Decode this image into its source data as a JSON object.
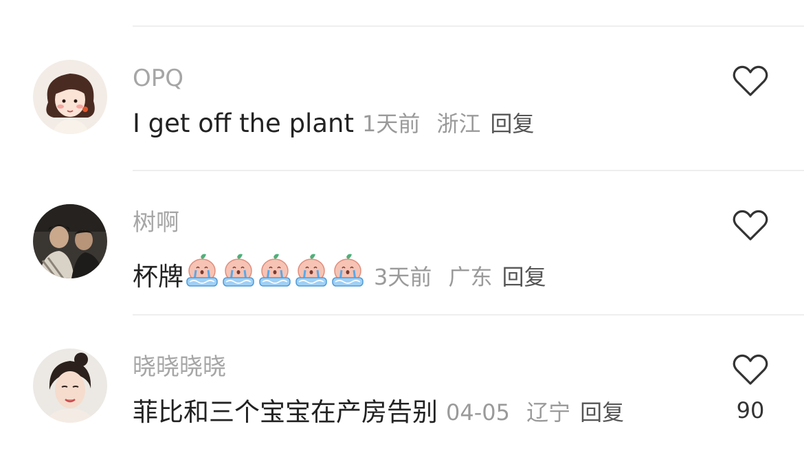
{
  "comments": [
    {
      "username": "OPQ",
      "text": "I get off the plant",
      "time": "1天前",
      "location": "浙江",
      "reply_label": "回复",
      "likes": ""
    },
    {
      "username": "树啊",
      "text": "杯牌",
      "emoji_icon": "crying-peach-emoji",
      "emoji_count": 5,
      "time": "3天前",
      "location": "广东",
      "reply_label": "回复",
      "likes": ""
    },
    {
      "username": "晓晓晓晓",
      "text": "菲比和三个宝宝在产房告别",
      "time": "04-05",
      "location": "辽宁",
      "reply_label": "回复",
      "likes": "90"
    }
  ],
  "colors": {
    "username": "#a6a6a6",
    "text": "#222222",
    "meta": "#9a9a9a",
    "reply": "#555555",
    "divider": "#eeeeee"
  }
}
